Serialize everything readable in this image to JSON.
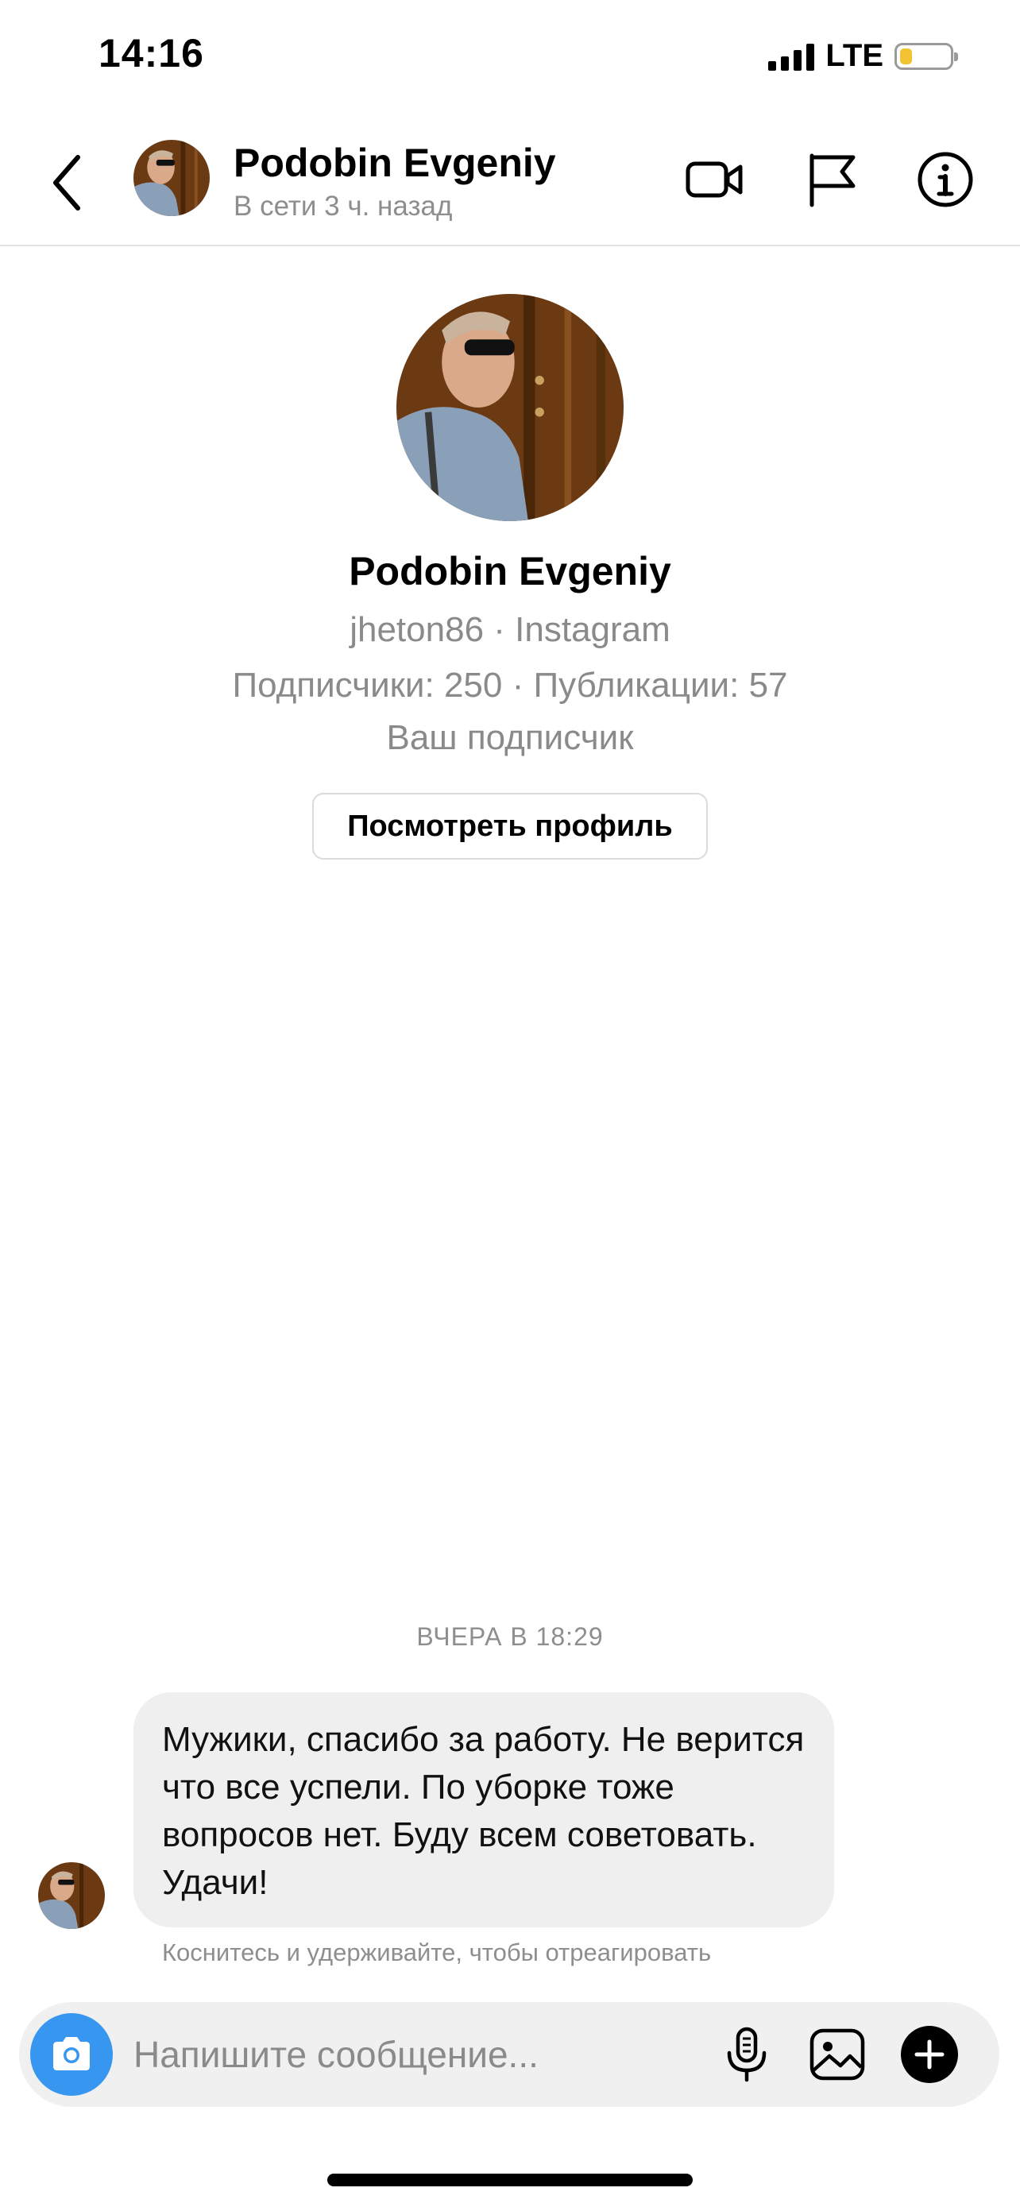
{
  "status_bar": {
    "time": "14:16",
    "network": "LTE",
    "battery_level": 0.25,
    "battery_color": "#f2c230"
  },
  "header": {
    "back_icon": "chevron-left-icon",
    "name": "Podobin Evgeniy",
    "status": "В сети 3 ч. назад",
    "actions": [
      "video-call-icon",
      "flag-icon",
      "info-icon"
    ]
  },
  "profile": {
    "name": "Podobin Evgeniy",
    "handle": "jheton86 · Instagram",
    "stats": "Подписчики: 250 · Публикации: 57",
    "relation": "Ваш подписчик",
    "view_profile_label": "Посмотреть профиль"
  },
  "chat": {
    "timestamp": "ВЧЕРА В 18:29",
    "messages": [
      {
        "from": "Podobin Evgeniy",
        "text": "Мужики, спасибо за работу. Не верится что все успели. По уборке тоже вопросов нет. Буду всем советовать. Удачи!"
      }
    ],
    "reaction_hint": "Коснитесь и удерживайте, чтобы отреагировать"
  },
  "composer": {
    "placeholder": "Напишите сообщение...",
    "icons": [
      "camera-icon",
      "microphone-icon",
      "gallery-icon",
      "plus-icon"
    ],
    "camera_color": "#3797f0"
  }
}
